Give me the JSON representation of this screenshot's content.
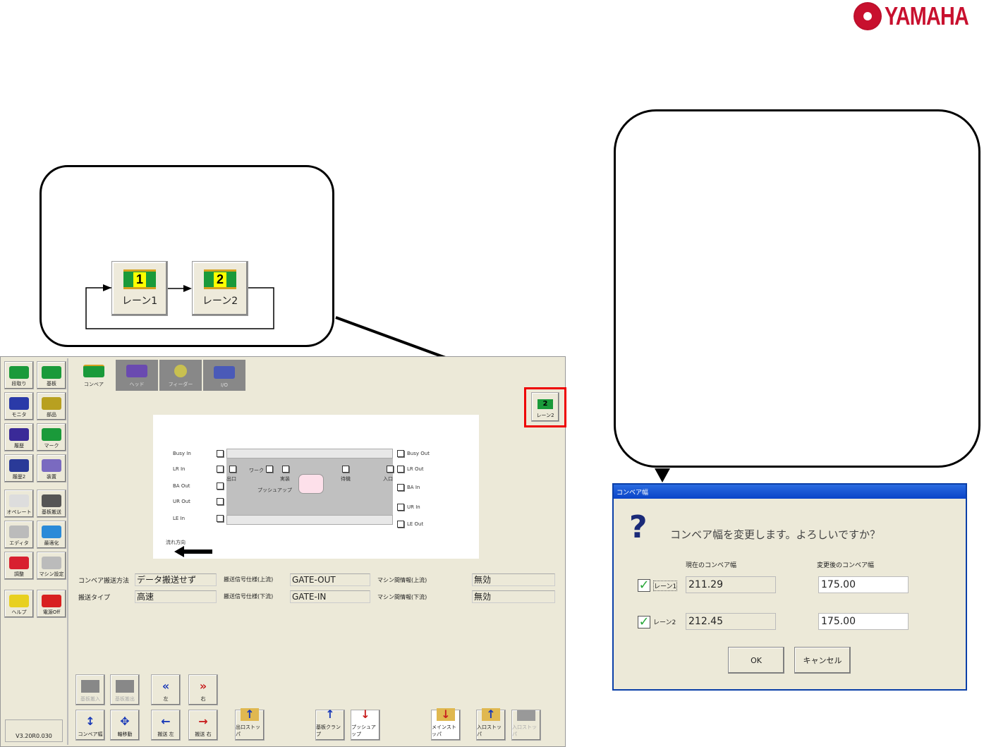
{
  "brand": {
    "name": "YAMAHA"
  },
  "lane_diagram": {
    "lane1_label": "レーン1",
    "lane1_num": "1",
    "lane2_label": "レーン2",
    "lane2_num": "2"
  },
  "sidebar": {
    "items": [
      {
        "label": "段取り"
      },
      {
        "label": "基板"
      },
      {
        "label": "モニタ"
      },
      {
        "label": "部品"
      },
      {
        "label": "履歴"
      },
      {
        "label": "マーク"
      },
      {
        "label": "履歴2"
      },
      {
        "label": "装置"
      },
      {
        "label": "オペレート"
      },
      {
        "label": "基板搬送"
      },
      {
        "label": "エディタ"
      },
      {
        "label": "最適化"
      },
      {
        "label": "調整"
      },
      {
        "label": "マシン設定"
      },
      {
        "label": "ヘルプ"
      },
      {
        "label": "電源Off"
      }
    ],
    "version": "V3.20R0.030"
  },
  "tabs": [
    {
      "label": "コンベア"
    },
    {
      "label": "ヘッド"
    },
    {
      "label": "フィーダー"
    },
    {
      "label": "I/O"
    }
  ],
  "lane_button": {
    "label": "レーン2",
    "num": "2"
  },
  "conveyor": {
    "left_signals": [
      "Busy In",
      "LR In",
      "BA Out",
      "UR Out",
      "LE In"
    ],
    "right_signals": [
      "Busy Out",
      "LR Out",
      "BA In",
      "UR In",
      "LE Out"
    ],
    "exit": "出口",
    "work": "ワーク",
    "wait1": "実装",
    "wait2": "待機",
    "entry": "入口",
    "pushup": "プッシュアップ",
    "flow_direction": "流れ方向"
  },
  "fields": {
    "method_label": "コンベア搬送方法",
    "method_value": "データ搬送せず",
    "type_label": "搬送タイプ",
    "type_value": "高速",
    "sig_up_label": "搬送信号仕様(上流)",
    "sig_up_value": "GATE-OUT",
    "sig_down_label": "搬送信号仕様(下流)",
    "sig_down_value": "GATE-IN",
    "comm_up_label": "マシン間情報(上流)",
    "comm_up_value": "無効",
    "comm_down_label": "マシン間情報(下流)",
    "comm_down_value": "無効"
  },
  "bottom_buttons": {
    "board_in": "基板搬入",
    "board_out": "基板搬出",
    "left": "左",
    "right": "右",
    "width": "コンベア幅",
    "axis": "軸移動",
    "conv_left": "搬送 左",
    "conv_right": "搬送 右",
    "exit_stopper": "出口ストッパ",
    "clamp": "基板クランプ",
    "pushup": "プッシュアップ",
    "main_stopper": "メインストッパ",
    "entry_stopper": "入口ストッパ",
    "entry_stopper2": "入口ストッパ"
  },
  "dialog": {
    "title": "コンベア幅",
    "message": "コンベア幅を変更します。よろしいですか？",
    "current_header": "現在のコンベア幅",
    "new_header": "変更後のコンベア幅",
    "rows": [
      {
        "lane": "レーン1",
        "checked": true,
        "current": "211.29",
        "new": "175.00"
      },
      {
        "lane": "レーン2",
        "checked": true,
        "current": "212.45",
        "new": "175.00"
      }
    ],
    "ok": "OK",
    "cancel": "キャンセル"
  }
}
